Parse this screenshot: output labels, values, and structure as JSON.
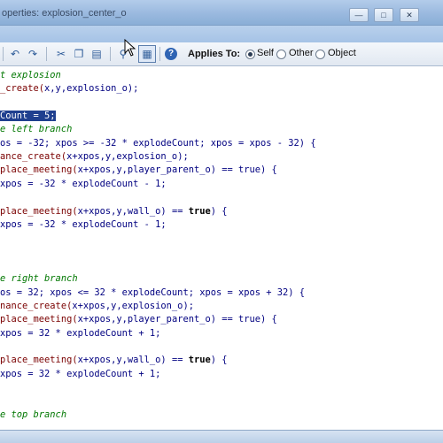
{
  "window": {
    "title": "operties: explosion_center_o",
    "minimize_icon": "minimize-icon",
    "maximize_icon": "maximize-icon",
    "close_icon": "close-icon"
  },
  "toolbar": {
    "icons": [
      "undo-icon",
      "redo-icon",
      "cut-icon",
      "copy-icon",
      "paste-icon",
      "find-icon",
      "toggle-icon",
      "help-icon"
    ],
    "applies_to_label": "Applies To:",
    "options": [
      {
        "label": "Self",
        "selected": true
      },
      {
        "label": "Other",
        "selected": false
      },
      {
        "label": "Object",
        "selected": false
      }
    ]
  },
  "code": {
    "lines": [
      {
        "segments": [
          {
            "t": "t explosion",
            "c": "comment"
          }
        ]
      },
      {
        "segments": [
          {
            "t": "_create(",
            "c": "fn"
          },
          {
            "t": "x,y,explosion_o);",
            "c": "plain"
          }
        ]
      },
      {
        "segments": [
          {
            "t": "",
            "c": "plain"
          }
        ]
      },
      {
        "segments": [
          {
            "t": "Count = 5;",
            "c": "sel"
          }
        ]
      },
      {
        "segments": [
          {
            "t": "e left branch",
            "c": "comment"
          }
        ]
      },
      {
        "segments": [
          {
            "t": "os = -32; xpos >= -32 * explodeCount; xpos = xpos - 32) {",
            "c": "plain"
          }
        ]
      },
      {
        "segments": [
          {
            "t": "ance_create(",
            "c": "fn"
          },
          {
            "t": "x+xpos,y,explosion_o);",
            "c": "plain"
          }
        ]
      },
      {
        "segments": [
          {
            "t": "place_meeting(",
            "c": "fn"
          },
          {
            "t": "x+xpos,y,player_parent_o) == true) {",
            "c": "plain"
          }
        ]
      },
      {
        "segments": [
          {
            "t": "xpos = -32 * explodeCount - 1;",
            "c": "plain"
          }
        ]
      },
      {
        "segments": [
          {
            "t": "",
            "c": "plain"
          }
        ]
      },
      {
        "segments": [
          {
            "t": "place_meeting(",
            "c": "fn"
          },
          {
            "t": "x+xpos,y,wall_o) == ",
            "c": "plain"
          },
          {
            "t": "true",
            "c": "kw"
          },
          {
            "t": ") {",
            "c": "plain"
          }
        ]
      },
      {
        "segments": [
          {
            "t": "xpos = -32 * explodeCount - 1;",
            "c": "plain"
          }
        ]
      },
      {
        "segments": [
          {
            "t": "",
            "c": "plain"
          }
        ]
      },
      {
        "segments": [
          {
            "t": "",
            "c": "plain"
          }
        ]
      },
      {
        "segments": [
          {
            "t": "",
            "c": "plain"
          }
        ]
      },
      {
        "segments": [
          {
            "t": "e right branch",
            "c": "comment"
          }
        ]
      },
      {
        "segments": [
          {
            "t": "os = 32; xpos <= 32 * explodeCount; xpos = xpos + 32) {",
            "c": "plain"
          }
        ]
      },
      {
        "segments": [
          {
            "t": "nance_create(",
            "c": "fn"
          },
          {
            "t": "x+xpos,y,explosion_o);",
            "c": "plain"
          }
        ]
      },
      {
        "segments": [
          {
            "t": "place_meeting(",
            "c": "fn"
          },
          {
            "t": "x+xpos,y,player_parent_o) == true) {",
            "c": "plain"
          }
        ]
      },
      {
        "segments": [
          {
            "t": "xpos = 32 * explodeCount + 1;",
            "c": "plain"
          }
        ]
      },
      {
        "segments": [
          {
            "t": "",
            "c": "plain"
          }
        ]
      },
      {
        "segments": [
          {
            "t": "place_meeting(",
            "c": "fn"
          },
          {
            "t": "x+xpos,y,wall_o) == ",
            "c": "plain"
          },
          {
            "t": "true",
            "c": "kw"
          },
          {
            "t": ") {",
            "c": "plain"
          }
        ]
      },
      {
        "segments": [
          {
            "t": "xpos = 32 * explodeCount + 1;",
            "c": "plain"
          }
        ]
      },
      {
        "segments": [
          {
            "t": "",
            "c": "plain"
          }
        ]
      },
      {
        "segments": [
          {
            "t": "",
            "c": "plain"
          }
        ]
      },
      {
        "segments": [
          {
            "t": "e top branch",
            "c": "comment"
          }
        ]
      }
    ]
  }
}
